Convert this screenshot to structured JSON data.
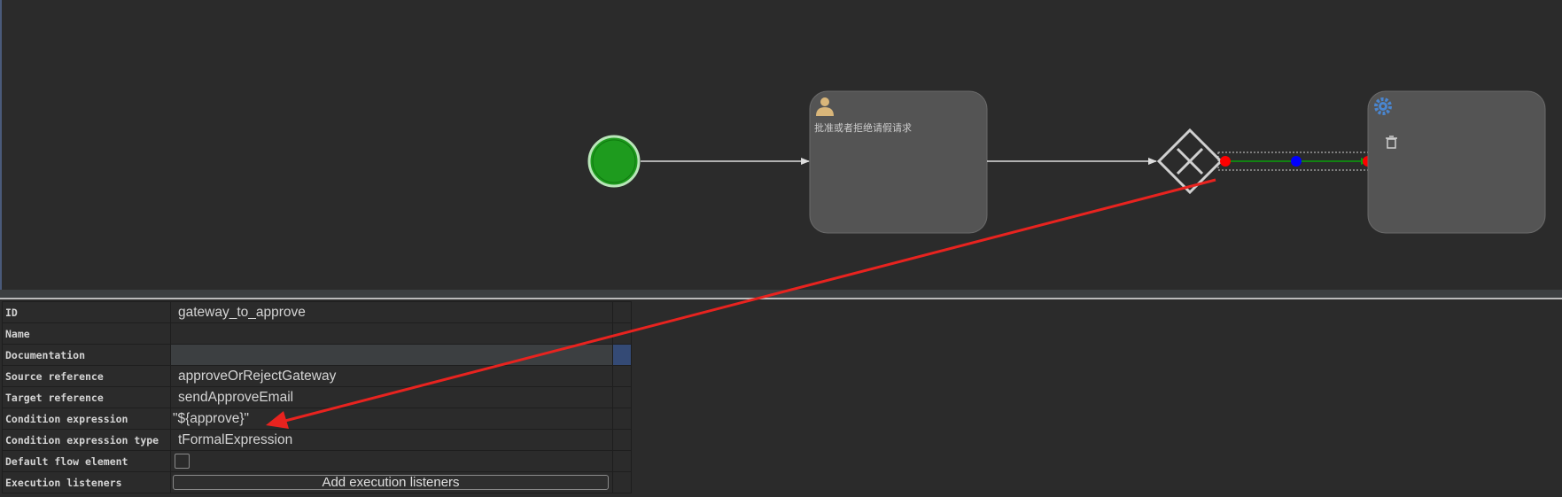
{
  "diagram": {
    "task_name": "批准或者拒绝请假请求"
  },
  "properties": [
    {
      "key": "id",
      "label": "ID",
      "value": "gateway_to_approve"
    },
    {
      "key": "name",
      "label": "Name",
      "value": ""
    },
    {
      "key": "documentation",
      "label": "Documentation",
      "value": ""
    },
    {
      "key": "source",
      "label": "Source reference",
      "value": "approveOrRejectGateway"
    },
    {
      "key": "target",
      "label": "Target reference",
      "value": "sendApproveEmail"
    },
    {
      "key": "condition",
      "label": "Condition expression",
      "value": "\"${approve}\""
    },
    {
      "key": "condition_type",
      "label": "Condition expression type",
      "value": "tFormalExpression"
    },
    {
      "key": "default_flow",
      "label": "Default flow element",
      "value": ""
    },
    {
      "key": "listeners",
      "label": "Execution listeners",
      "value": "Add execution listeners"
    }
  ],
  "colors": {
    "start_event": "#1e9b1e",
    "task_fill": "#545454",
    "selection_line": "#0aa00a",
    "handle_end": "#ff0000",
    "handle_mid": "#0000ff",
    "annotation_arrow": "#e8231f",
    "user_icon": "#d9b67a",
    "gear_icon": "#4a86d0"
  },
  "icons": {
    "user_task": "user-icon",
    "service_task": "gear-icon",
    "delete": "trash-icon",
    "gateway": "exclusive-gateway-x"
  }
}
